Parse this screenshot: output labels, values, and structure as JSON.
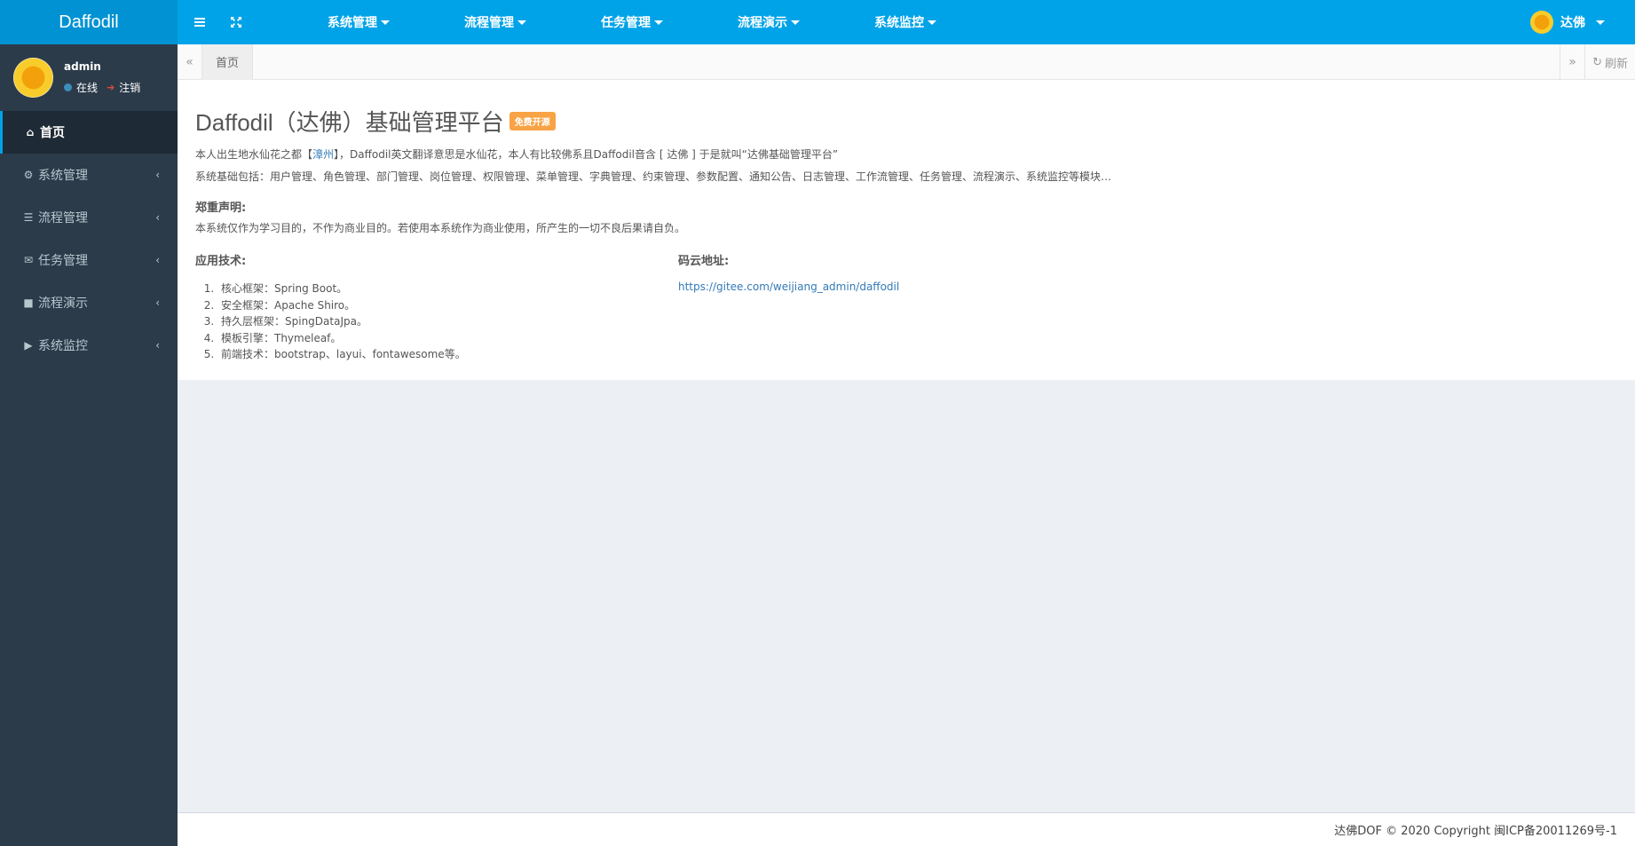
{
  "app": {
    "logo": "Daffodil"
  },
  "topnav": [
    {
      "label": "系统管理"
    },
    {
      "label": "流程管理"
    },
    {
      "label": "任务管理"
    },
    {
      "label": "流程演示"
    },
    {
      "label": "系统监控"
    }
  ],
  "user_menu": {
    "name": "达佛"
  },
  "sidebar": {
    "user": {
      "name": "admin",
      "status": "在线",
      "logout": "注销"
    },
    "items": [
      {
        "label": "首页",
        "icon": "home-icon"
      },
      {
        "label": "系统管理",
        "icon": "gear-icon"
      },
      {
        "label": "流程管理",
        "icon": "sliders-icon"
      },
      {
        "label": "任务管理",
        "icon": "envelope-icon"
      },
      {
        "label": "流程演示",
        "icon": "gift-icon"
      },
      {
        "label": "系统监控",
        "icon": "video-camera-icon"
      }
    ]
  },
  "tabs": {
    "active": "首页",
    "refresh": "刷新"
  },
  "main": {
    "title": "Daffodil（达佛）基础管理平台",
    "badge": "免费开源",
    "intro_pre": "本人出生地水仙花之都【",
    "intro_link": "漳州",
    "intro_post": "】，Daffodil英文翻译意思是水仙花，本人有比较佛系且Daffodil音含 [ 达佛 ] 于是就叫“达佛基础管理平台”",
    "modules": "系统基础包括：用户管理、角色管理、部门管理、岗位管理、权限管理、菜单管理、字典管理、约束管理、参数配置、通知公告、日志管理、工作流管理、任务管理、流程演示、系统监控等模块…",
    "disclaimer_title": "郑重声明:",
    "disclaimer": "本系统仅作为学习目的，不作为商业目的。若使用本系统作为商业使用，所产生的一切不良后果请自负。",
    "tech_title": "应用技术:",
    "tech": [
      "核心框架：Spring Boot。",
      "安全框架：Apache Shiro。",
      "持久层框架：SpingDataJpa。",
      "模板引擎：Thymeleaf。",
      "前端技术：bootstrap、layui、fontawesome等。"
    ],
    "repo_title": "码云地址:",
    "repo_url": "https://gitee.com/weijiang_admin/daffodil"
  },
  "footer": {
    "text": "达佛DOF © 2020 Copyright 闽ICP备20011269号-1"
  },
  "colors": {
    "topbar": "#00a3e8",
    "logo_bg": "#0092d2",
    "sidebar": "#2c3b4a",
    "badge": "#f8a345",
    "link": "#337ab7"
  }
}
